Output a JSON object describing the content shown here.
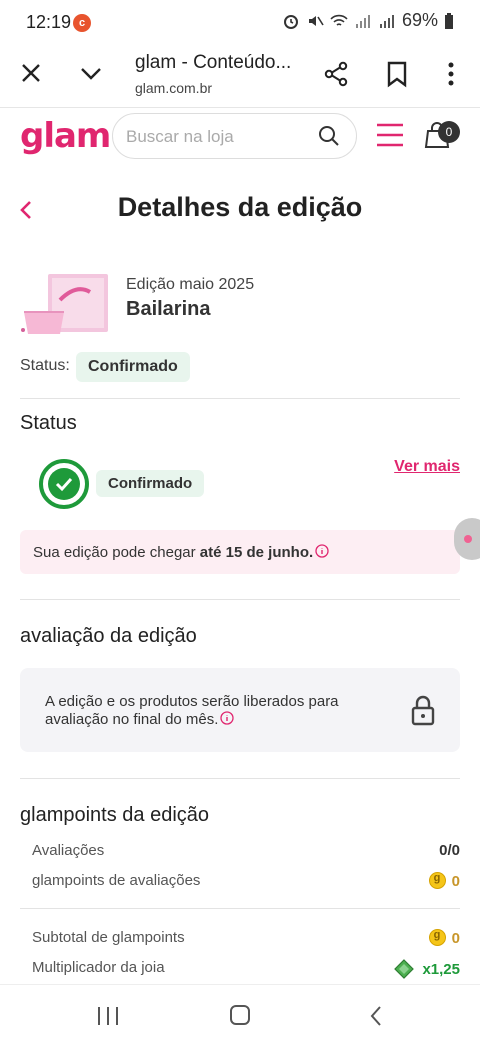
{
  "statusbar": {
    "time": "12:19",
    "battery": "69%"
  },
  "browser": {
    "title": "glam - Conteúdo...",
    "url": "glam.com.br"
  },
  "site": {
    "logo": "glam",
    "search_placeholder": "Buscar na loja",
    "cart_count": "0",
    "accent": "#e0266f"
  },
  "page": {
    "title": "Detalhes da edição"
  },
  "edition": {
    "label": "Edição maio 2025",
    "name": "Bailarina",
    "status_label": "Status:",
    "status_value": "Confirmado"
  },
  "status_section": {
    "title": "Status",
    "status_value": "Confirmado",
    "link": "Ver mais",
    "notice_prefix": "Sua edição pode chegar ",
    "notice_bold": "até 15 de junho."
  },
  "review_section": {
    "title": "avaliação da edição",
    "message": "A edição e os produtos serão liberados para avaliação no final do mês."
  },
  "points_section": {
    "title": "glampoints da edição",
    "rows": [
      {
        "label": "Avaliações",
        "value": "0/0"
      },
      {
        "label": "glampoints de avaliações",
        "value": "0"
      },
      {
        "label": "Subtotal de glampoints",
        "value": "0"
      },
      {
        "label": "Multiplicador da joia",
        "value": "x1,25"
      }
    ]
  }
}
